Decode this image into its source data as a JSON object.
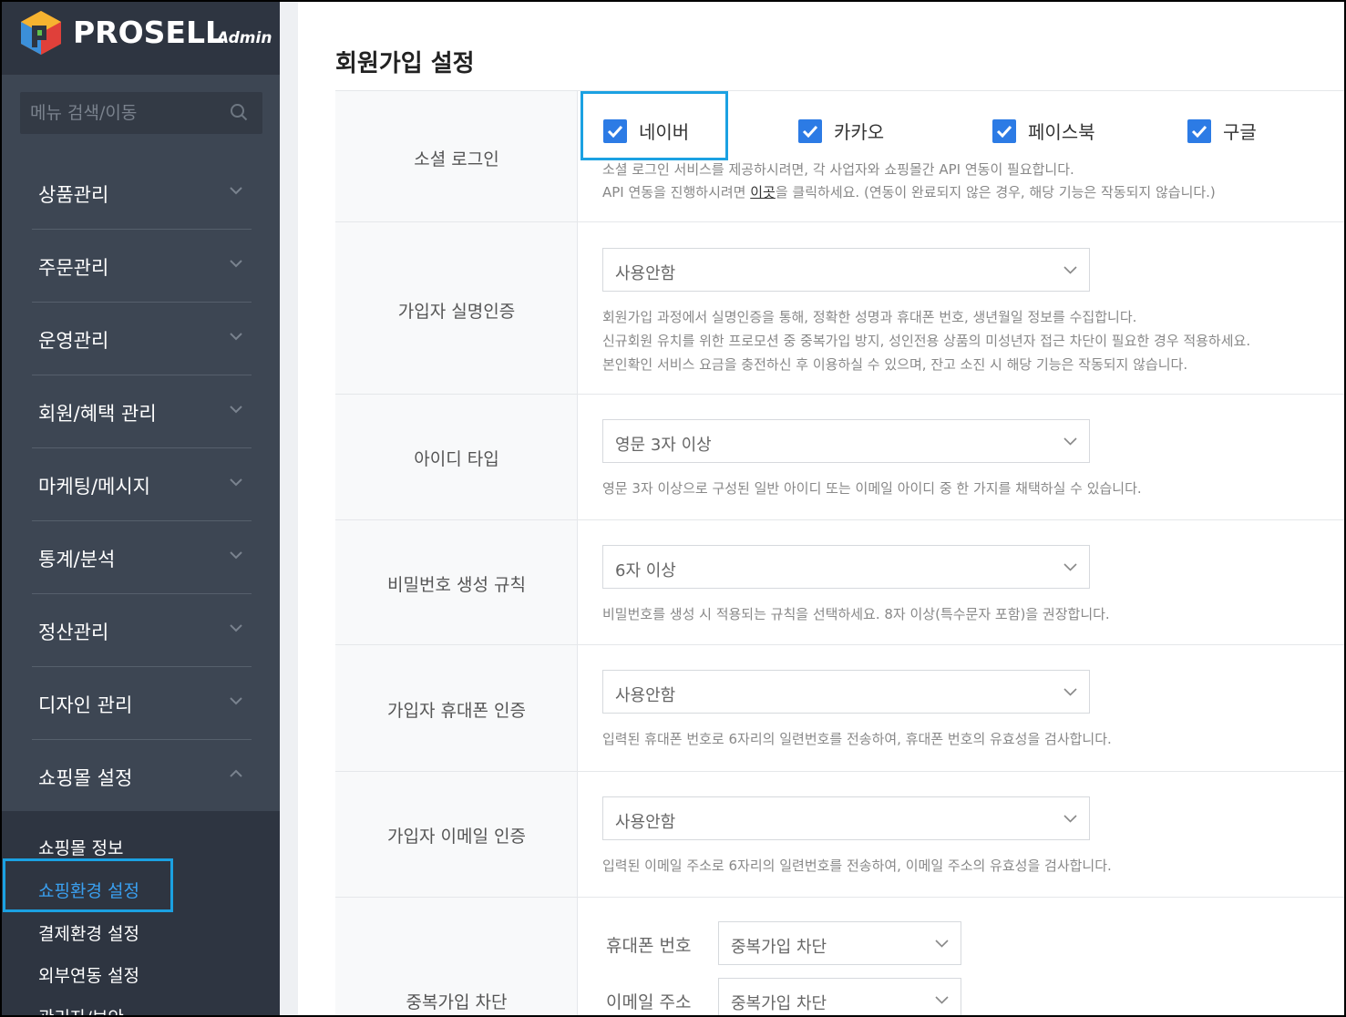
{
  "brand": {
    "name": "PROSELL",
    "sub": "Admin"
  },
  "search": {
    "placeholder": "메뉴 검색/이동"
  },
  "menu": [
    {
      "label": "상품관리"
    },
    {
      "label": "주문관리"
    },
    {
      "label": "운영관리"
    },
    {
      "label": "회원/혜택 관리"
    },
    {
      "label": "마케팅/메시지"
    },
    {
      "label": "통계/분석"
    },
    {
      "label": "정산관리"
    },
    {
      "label": "디자인 관리"
    },
    {
      "label": "쇼핑몰 설정"
    }
  ],
  "submenu": [
    {
      "label": "쇼핑몰 정보"
    },
    {
      "label": "쇼핑환경 설정"
    },
    {
      "label": "결제환경 설정"
    },
    {
      "label": "외부연동 설정"
    },
    {
      "label": "관리자/보안"
    }
  ],
  "page": {
    "title": "회원가입 설정"
  },
  "social": {
    "label": "소셜 로그인",
    "options": [
      "네이버",
      "카카오",
      "페이스북",
      "구글"
    ],
    "help1": "소셜 로그인 서비스를 제공하시려면, 각 사업자와 쇼핑몰간 API 연동이 필요합니다.",
    "help2a": "API 연동을 진행하시려면 ",
    "help2link": "이곳",
    "help2b": "을 클릭하세요. (연동이 완료되지 않은 경우, 해당 기능은 작동되지 않습니다.)"
  },
  "realname": {
    "label": "가입자 실명인증",
    "value": "사용안함",
    "help1": "회원가입 과정에서 실명인증을 통해, 정확한 성명과 휴대폰 번호, 생년월일 정보를 수집합니다.",
    "help2": "신규회원 유치를 위한 프로모션 중 중복가입 방지, 성인전용 상품의 미성년자 접근 차단이 필요한 경우 적용하세요.",
    "help3": "본인확인 서비스 요금을 충전하신 후 이용하실 수 있으며, 잔고 소진 시 해당 기능은 작동되지 않습니다."
  },
  "idtype": {
    "label": "아이디 타입",
    "value": "영문 3자 이상",
    "help": "영문 3자 이상으로 구성된 일반 아이디 또는 이메일 아이디 중 한 가지를 채택하실 수 있습니다."
  },
  "password": {
    "label": "비밀번호 생성 규칙",
    "value": "6자 이상",
    "help": "비밀번호를 생성 시 적용되는 규칙을 선택하세요. 8자 이상(특수문자 포함)을 권장합니다."
  },
  "phone": {
    "label": "가입자 휴대폰 인증",
    "value": "사용안함",
    "help": "입력된 휴대폰 번호로 6자리의 일련번호를 전송하여, 휴대폰 번호의 유효성을 검사합니다."
  },
  "email": {
    "label": "가입자 이메일 인증",
    "value": "사용안함",
    "help": "입력된 이메일 주소로 6자리의 일련번호를 전송하여, 이메일 주소의 유효성을 검사합니다."
  },
  "dup": {
    "label": "중복가입 차단",
    "phone_label": "휴대폰 번호",
    "phone_value": "중복가입 차단",
    "email_label": "이메일 주소",
    "email_value": "중복가입 차단"
  },
  "colors": {
    "sidebar": "#3d4653",
    "accent": "#2c7be5",
    "highlight": "#1ba1e2"
  }
}
